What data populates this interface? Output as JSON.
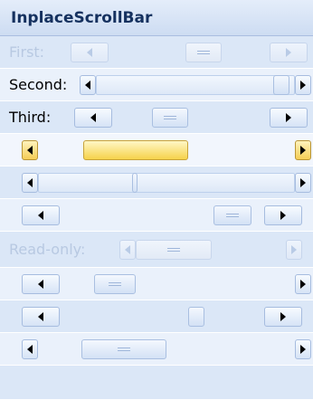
{
  "header": {
    "title": "InplaceScrollBar"
  },
  "rows": [
    {
      "label": "First:",
      "enabled": false
    },
    {
      "label": "Second:",
      "enabled": true
    },
    {
      "label": "Third:",
      "enabled": true
    },
    {
      "label": "",
      "enabled": true,
      "style": "yellow"
    },
    {
      "label": "",
      "enabled": true
    },
    {
      "label": "",
      "enabled": true
    },
    {
      "label": "Read-only:",
      "enabled": false
    },
    {
      "label": "",
      "enabled": true
    },
    {
      "label": "",
      "enabled": true
    },
    {
      "label": "",
      "enabled": true
    }
  ],
  "icons": {
    "left_arrow": "left-arrow-icon",
    "right_arrow": "right-arrow-icon"
  },
  "colors": {
    "panel_bg": "#eaf1fb",
    "header_text": "#15315f",
    "disabled_text": "#b8c9e2",
    "yellow_thumb": "#f6d24a"
  }
}
